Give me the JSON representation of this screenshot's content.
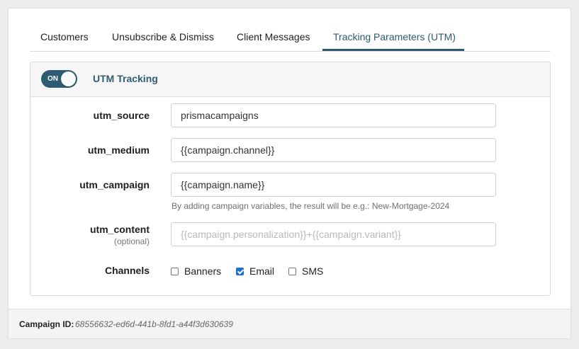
{
  "tabs": [
    {
      "label": "Customers"
    },
    {
      "label": "Unsubscribe & Dismiss"
    },
    {
      "label": "Client Messages"
    },
    {
      "label": "Tracking Parameters (UTM)"
    }
  ],
  "active_tab": "Tracking Parameters (UTM)",
  "panel": {
    "toggle": {
      "state": "ON"
    },
    "title": "UTM Tracking"
  },
  "fields": {
    "utm_source": {
      "label": "utm_source",
      "value": "prismacampaigns"
    },
    "utm_medium": {
      "label": "utm_medium",
      "value": "{{campaign.channel}}"
    },
    "utm_campaign": {
      "label": "utm_campaign",
      "value": "{{campaign.name}}"
    },
    "utm_campaign_hint": "By adding campaign variables, the result will be e.g.: New-Mortgage-2024",
    "utm_content": {
      "label": "utm_content",
      "sublabel": "(optional)",
      "value": "",
      "placeholder": "{{campaign.personalization}}+{{campaign.variant}}"
    }
  },
  "channels": {
    "label": "Channels",
    "options": [
      {
        "label": "Banners",
        "checked": false
      },
      {
        "label": "Email",
        "checked": true
      },
      {
        "label": "SMS",
        "checked": false
      }
    ]
  },
  "footer": {
    "label": "Campaign ID:",
    "id": "68556632-ed6d-441b-8fd1-a44f3d630639"
  },
  "colors": {
    "accent": "#2e5c73",
    "checkbox_checked": "#1d6fd6"
  }
}
